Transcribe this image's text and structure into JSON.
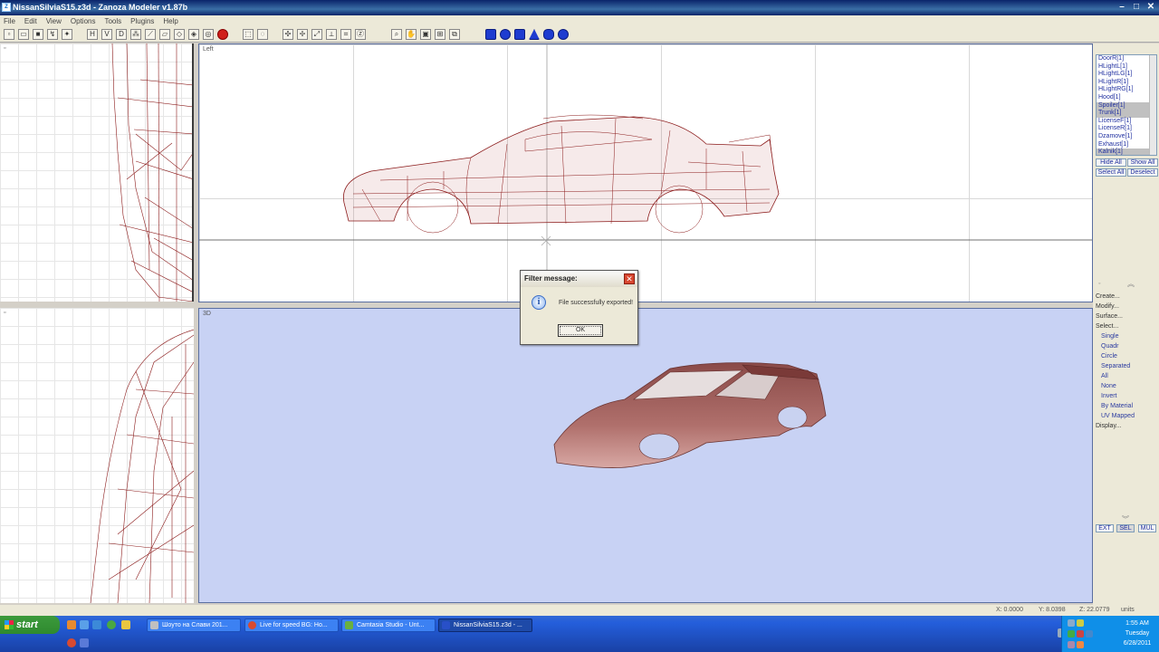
{
  "window": {
    "title": "NissanSilviaS15.z3d - Zanoza Modeler v1.87b",
    "icon_name": "app-icon"
  },
  "menu": {
    "items": [
      "File",
      "Edit",
      "View",
      "Options",
      "Tools",
      "Plugins",
      "Help"
    ]
  },
  "toolbar": {
    "axis_h": "H",
    "axis_v": "V",
    "axis_d": "D"
  },
  "viewports": {
    "left_label": "Left",
    "persp_label": "3D"
  },
  "object_list": {
    "items": [
      "DoorR[1]",
      "HLightL[1]",
      "HLightLG[1]",
      "HLightR[1]",
      "HLightRG[1]",
      "Hood[1]",
      "Spoiler[1]",
      "Trunk[1]",
      "LicenseF[1]",
      "LicenseR[1]",
      "Dzamove[1]",
      "Exhaust[1]",
      "Kalnik[1]"
    ],
    "selected": [
      "Spoiler[1]",
      "Trunk[1]",
      "Kalnik[1]"
    ]
  },
  "panel": {
    "hide_all": "Hide All",
    "show_all": "Show All",
    "select_all": "Select All",
    "deselect": "Deselect",
    "create": "Create...",
    "modify": "Modify...",
    "surface": "Surface...",
    "select": "Select...",
    "select_options": [
      "Single",
      "Quadr",
      "Circle",
      "Separated",
      "All",
      "None",
      "Invert",
      "By Material",
      "UV Mapped"
    ],
    "display": "Display...",
    "mode_ext": "EXT",
    "mode_sel": "SEL",
    "mode_mul": "MUL"
  },
  "status": {
    "x": "X: 0.0000",
    "y": "Y: 8.0398",
    "z": "Z: 22.0779",
    "units": "units"
  },
  "dialog": {
    "title": "Filter message:",
    "message": "File successfully exported!",
    "ok": "OK"
  },
  "taskbar": {
    "start": "start",
    "tasks": [
      "Шоуто на Слави 201...",
      "Live for speed BG: Ho...",
      "Camtasia Studio - Unt...",
      "NissanSilviaS15.z3d - ..."
    ],
    "clock": {
      "time": "1:55 AM",
      "day": "Tuesday",
      "date": "6/28/2011"
    }
  },
  "colors": {
    "wire": "#8b1a1a",
    "viewport_3d": "#c8d2f4",
    "titlebar": "#0a246a",
    "taskbar": "#245edb"
  }
}
